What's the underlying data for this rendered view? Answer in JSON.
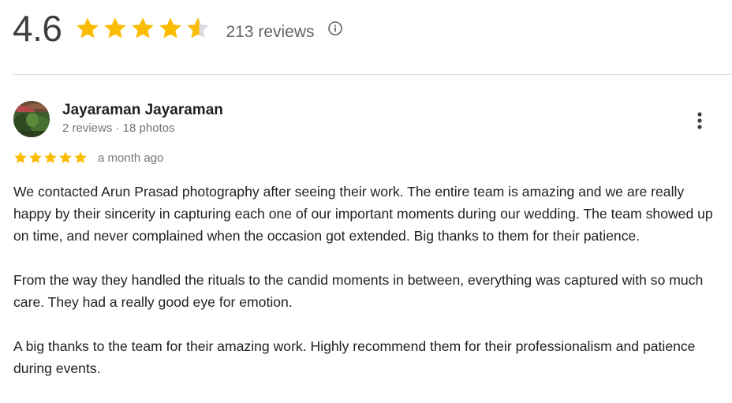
{
  "summary": {
    "rating": "4.6",
    "stars_filled": 4.6,
    "reviews_label": "213 reviews",
    "info_icon": "info-icon"
  },
  "review": {
    "author": "Jayaraman Jayaraman",
    "meta": "2 reviews · 18 photos",
    "stars": 5,
    "date": "a month ago",
    "paragraphs": [
      "We contacted Arun Prasad photography after seeing their work. The entire team is amazing and we are really happy by their sincerity in capturing each one of our important moments during our wedding. The team showed up on time, and never complained when the occasion got extended. Big thanks to them for their patience.",
      "From the way they handled the rituals to the candid moments in between, everything was captured with so much care. They had a really good eye for emotion.",
      "A big thanks to the team for their amazing work. Highly recommend them for their professionalism and patience during events."
    ],
    "more_icon": "more-vert-icon"
  },
  "colors": {
    "star": "#fbbc04",
    "star_empty": "#dadce0",
    "divider": "#dadce0",
    "muted_text": "#70757a"
  }
}
